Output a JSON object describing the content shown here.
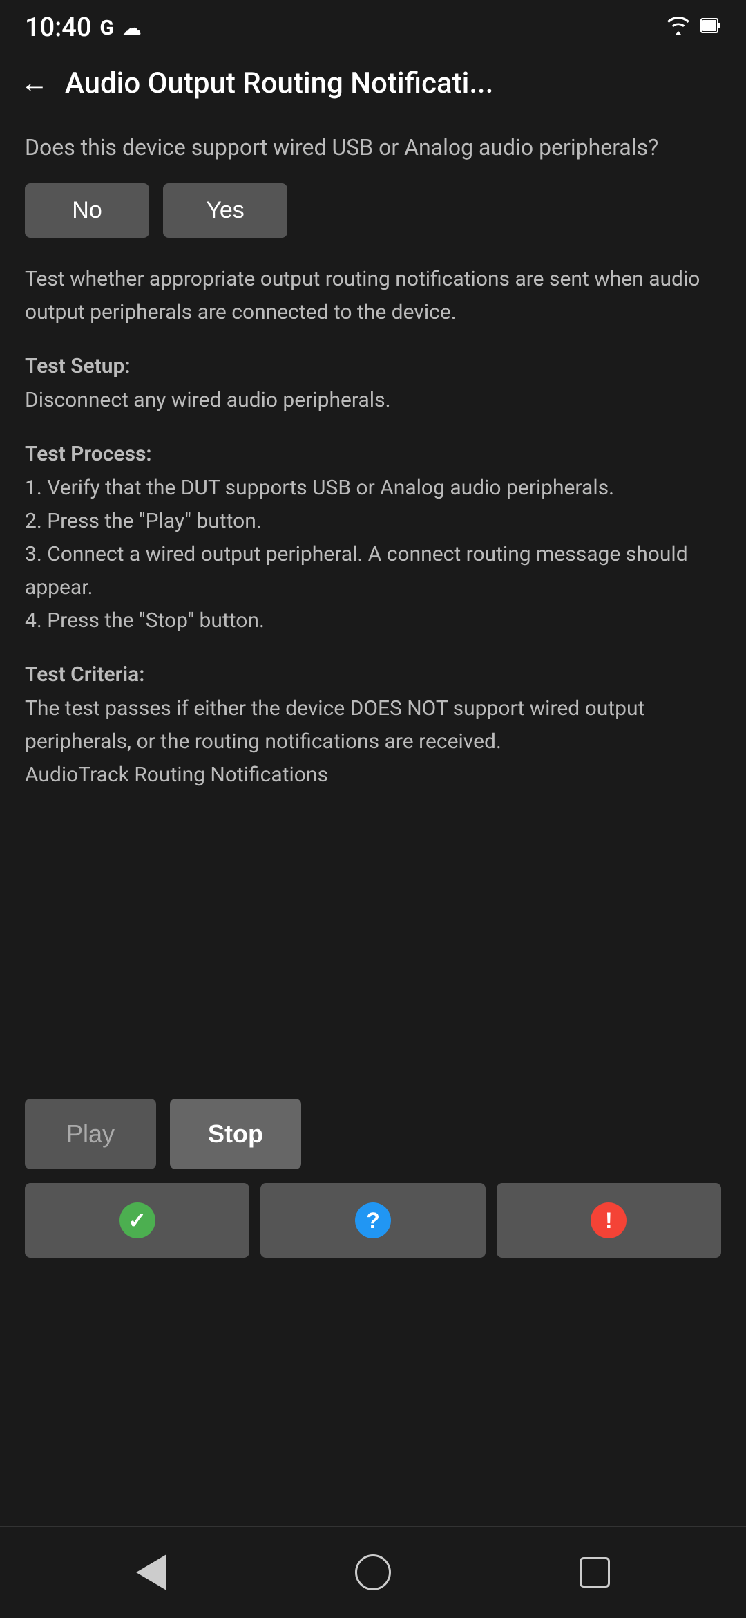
{
  "statusBar": {
    "time": "10:40",
    "googleLabel": "G",
    "cloudLabel": "☁"
  },
  "appBar": {
    "title": "Audio Output Routing Notificati...",
    "backLabel": "←"
  },
  "content": {
    "questionText": "Does this device support wired USB or Analog audio peripherals?",
    "noLabel": "No",
    "yesLabel": "Yes",
    "descriptionText": "Test whether appropriate output routing notifications are sent when audio output peripherals are connected to the device.",
    "testSetupLabel": "Test Setup:",
    "testSetupBody": "Disconnect any wired audio peripherals.",
    "testProcessLabel": "Test Process:",
    "testProcessBody": "1. Verify that the DUT supports USB or Analog audio peripherals.\n2. Press the \"Play\" button.\n3. Connect a wired output peripheral. A connect routing message should appear.\n4. Press the \"Stop\" button.",
    "testCriteriaLabel": "Test Criteria:",
    "testCriteriaBody": "The test passes if either the device DOES NOT support wired output peripherals, or the routing notifications are received.\nAudioTrack Routing Notifications"
  },
  "actionArea": {
    "playLabel": "Play",
    "stopLabel": "Stop",
    "passIcon": "✓",
    "helpIcon": "?",
    "failIcon": "!"
  },
  "navBar": {
    "backLabel": "◀",
    "homeLabel": "○",
    "recentsLabel": "□"
  }
}
